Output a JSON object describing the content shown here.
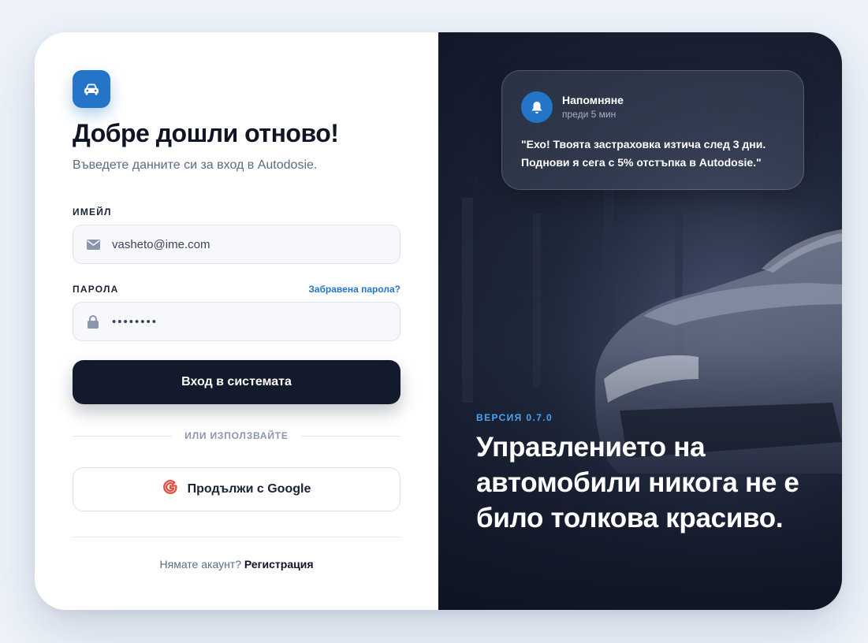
{
  "login": {
    "title": "Добре дошли отново!",
    "subtitle": "Въведете данните си за вход в Autodosie.",
    "email_label": "ИМЕЙЛ",
    "email_value": "vasheto@ime.com",
    "password_label": "ПАРОЛА",
    "forgot_label": "Забравена парола?",
    "password_value": "••••••••",
    "submit_label": "Вход в системата",
    "divider_text": "ИЛИ ИЗПОЛЗВАЙТЕ",
    "google_label": "Продължи с Google",
    "no_account_text": "Нямате акаунт?",
    "register_label": "Регистрация"
  },
  "notification": {
    "title": "Напомняне",
    "time": "преди 5 мин",
    "message": "\"Ехо! Твоята застраховка изтича след 3 дни. Поднови я сега с 5% отстъпка в Autodosie.\""
  },
  "promo": {
    "version": "ВЕРСИЯ 0.7.0",
    "headline": "Управлението на автомобили никога не е било толкова красиво."
  },
  "icons": {
    "logo": "car-icon",
    "email": "envelope-icon",
    "password": "lock-icon",
    "google": "google-icon",
    "notification": "bell-icon"
  },
  "colors": {
    "accent": "#2474c8",
    "dark_button": "#131a2b",
    "version_text": "#4aa3f0",
    "background": "#eef3fa"
  }
}
